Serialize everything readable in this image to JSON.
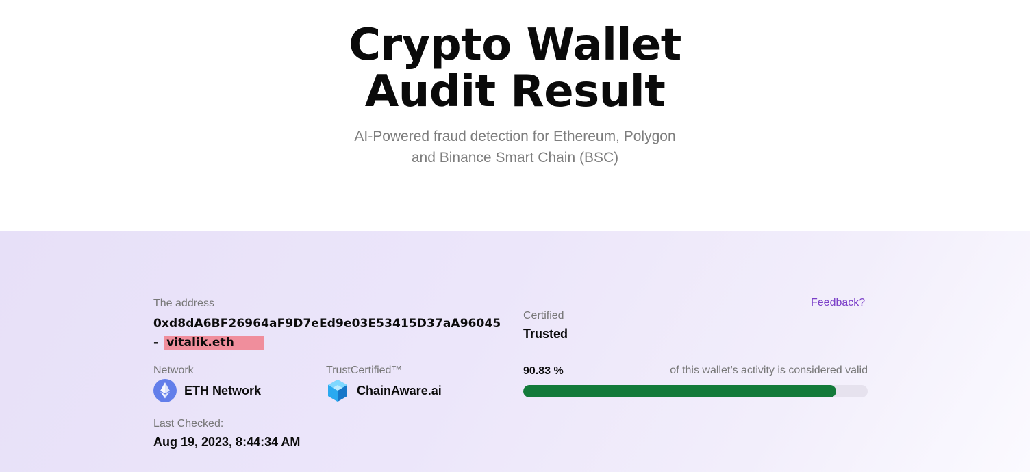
{
  "hero": {
    "title_line1": "Crypto Wallet",
    "title_line2": "Audit Result",
    "subtitle_line1": "AI-Powered fraud detection for Ethereum, Polygon",
    "subtitle_line2": "and Binance Smart Chain (BSC)"
  },
  "audit": {
    "address_label": "The address",
    "address_value": "0xd8dA6BF26964aF9D7eEd9e03E53415D37aA96045",
    "address_prefix": "- ",
    "ens_name": "vitalik.eth",
    "feedback_link": "Feedback?",
    "certified_label": "Certified",
    "certified_value": "Trusted",
    "network_label": "Network",
    "network_value": "ETH Network",
    "network_icon": "ethereum-icon",
    "trust_label": "TrustCertified™",
    "trust_value": "ChainAware.ai",
    "trust_icon": "chainaware-cube-icon",
    "percent_text": "90.83 %",
    "percent_value": 90.83,
    "percent_caption": "of this wallet’s activity is considered valid",
    "last_checked_label": "Last Checked:",
    "last_checked_value": "Aug 19, 2023, 8:44:34 AM"
  },
  "colors": {
    "accent": "#7b3fc8",
    "progress_fill": "#137a3a",
    "progress_track": "#e6e2ee",
    "highlight": "#f08e9c",
    "eth_icon": "#627eea"
  }
}
